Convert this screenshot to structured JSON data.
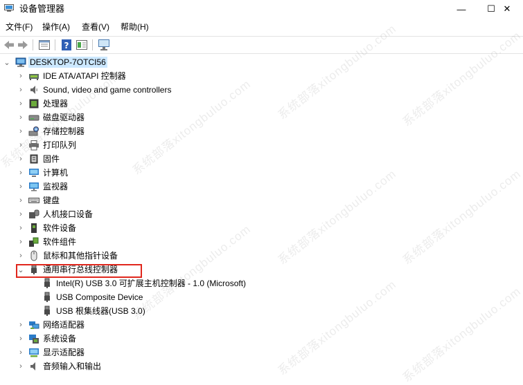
{
  "window": {
    "title": "设备管理器",
    "minimize": "—",
    "maximize": "☐",
    "close": "✕"
  },
  "menu": {
    "file": "文件(F)",
    "action": "操作(A)",
    "view": "查看(V)",
    "help": "帮助(H)"
  },
  "tree": {
    "root": "DESKTOP-7OTCI56",
    "items": [
      {
        "label": "IDE ATA/ATAPI 控制器",
        "icon": "ide-controller-icon"
      },
      {
        "label": "Sound, video and game controllers",
        "icon": "speaker-icon"
      },
      {
        "label": "处理器",
        "icon": "processor-icon"
      },
      {
        "label": "磁盘驱动器",
        "icon": "disk-drive-icon"
      },
      {
        "label": "存储控制器",
        "icon": "storage-controller-icon"
      },
      {
        "label": "打印队列",
        "icon": "printer-icon"
      },
      {
        "label": "固件",
        "icon": "firmware-icon"
      },
      {
        "label": "计算机",
        "icon": "computer-icon"
      },
      {
        "label": "监视器",
        "icon": "monitor-icon"
      },
      {
        "label": "键盘",
        "icon": "keyboard-icon"
      },
      {
        "label": "人机接口设备",
        "icon": "hid-icon"
      },
      {
        "label": "软件设备",
        "icon": "software-device-icon"
      },
      {
        "label": "软件组件",
        "icon": "software-component-icon"
      },
      {
        "label": "鼠标和其他指针设备",
        "icon": "mouse-icon"
      },
      {
        "label": "通用串行总线控制器",
        "icon": "usb-icon",
        "expanded": true
      },
      {
        "label": "Intel(R) USB 3.0 可扩展主机控制器 - 1.0 (Microsoft)",
        "icon": "usb-icon",
        "child": true
      },
      {
        "label": "USB Composite Device",
        "icon": "usb-icon",
        "child": true
      },
      {
        "label": "USB 根集线器(USB 3.0)",
        "icon": "usb-icon",
        "child": true
      },
      {
        "label": "网络适配器",
        "icon": "network-adapter-icon"
      },
      {
        "label": "系统设备",
        "icon": "system-device-icon"
      },
      {
        "label": "显示适配器",
        "icon": "display-adapter-icon"
      },
      {
        "label": "音频输入和输出",
        "icon": "audio-io-icon"
      }
    ]
  },
  "watermark": "系统部落xitongbuluo.com"
}
